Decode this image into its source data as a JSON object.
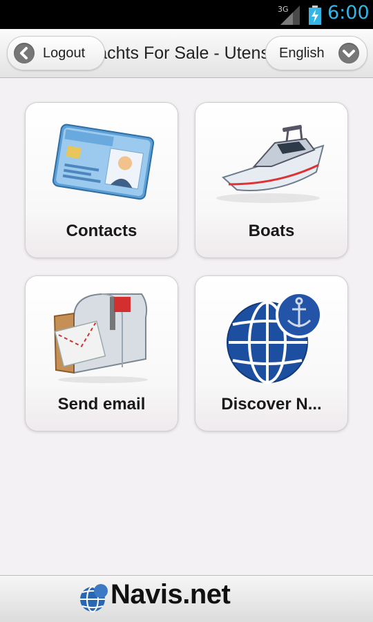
{
  "status_bar": {
    "network": "3G",
    "time": "6:00",
    "time_color": "#33b5e5"
  },
  "header": {
    "title": "Yachts For Sale - Utensils",
    "logout_label": "Logout",
    "language_label": "English"
  },
  "tiles": [
    {
      "label": "Contacts",
      "icon": "identity-card-icon"
    },
    {
      "label": "Boats",
      "icon": "boat-icon"
    },
    {
      "label": "Send email",
      "icon": "mailbox-icon"
    },
    {
      "label": "Discover N...",
      "icon": "globe-anchor-icon"
    }
  ],
  "footer": {
    "brand": "Navis.net",
    "icon": "globe-icon"
  }
}
